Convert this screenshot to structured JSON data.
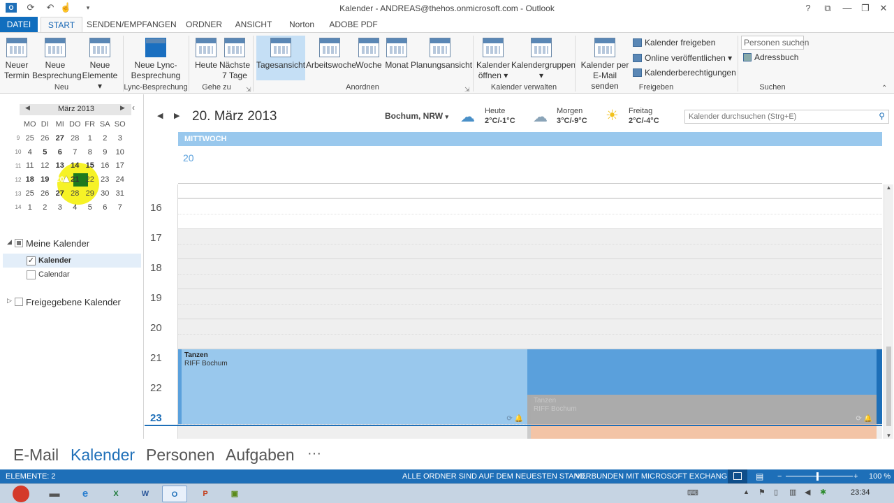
{
  "window": {
    "title": "Kalender - ANDREAS@thehos.onmicrosoft.com - Outlook",
    "help": "?"
  },
  "tabs": [
    "DATEI",
    "START",
    "SENDEN/EMPFANGEN",
    "ORDNER",
    "ANSICHT",
    "Norton",
    "ADOBE PDF"
  ],
  "ribbon": {
    "neu": {
      "termin": [
        "Neuer",
        "Termin"
      ],
      "besprechung": [
        "Neue",
        "Besprechung"
      ],
      "elemente": [
        "Neue",
        "Elemente ▾"
      ],
      "group": "Neu"
    },
    "lync": {
      "label": [
        "Neue Lync-",
        "Besprechung"
      ],
      "group": "Lync-Besprechung"
    },
    "gehezu": {
      "heute": "Heute",
      "naechste": [
        "Nächste",
        "7 Tage"
      ],
      "group": "Gehe zu"
    },
    "anordnen": {
      "items": [
        "Tagesansicht",
        "Arbeitswoche",
        "Woche",
        "Monat",
        "Planungsansicht"
      ],
      "group": "Anordnen"
    },
    "verwalten": {
      "oeffnen": [
        "Kalender",
        "öffnen ▾"
      ],
      "gruppen": [
        "Kalendergruppen",
        "▾"
      ],
      "group": "Kalender verwalten"
    },
    "freigeben": {
      "email": [
        "Kalender per",
        "E-Mail senden"
      ],
      "items": [
        "Kalender freigeben",
        "Online veröffentlichen ▾",
        "Kalenderberechtigungen"
      ],
      "group": "Freigeben"
    },
    "suchen": {
      "personen": "Personen suchen",
      "adressbuch": "Adressbuch",
      "group": "Suchen"
    }
  },
  "minical": {
    "month": "März 2013",
    "days": [
      "MO",
      "DI",
      "MI",
      "DO",
      "FR",
      "SA",
      "SO"
    ],
    "weeks": [
      [
        "9",
        "25",
        "26",
        "27",
        "28",
        "1",
        "2",
        "3"
      ],
      [
        "10",
        "4",
        "5",
        "6",
        "7",
        "8",
        "9",
        "10"
      ],
      [
        "11",
        "11",
        "12",
        "13",
        "14",
        "15",
        "16",
        "17"
      ],
      [
        "12",
        "18",
        "19",
        "20",
        "21",
        "22",
        "23",
        "24"
      ],
      [
        "13",
        "25",
        "26",
        "27",
        "28",
        "29",
        "30",
        "31"
      ],
      [
        "14",
        "1",
        "2",
        "3",
        "4",
        "5",
        "6",
        "7"
      ]
    ]
  },
  "folders": {
    "mine": "Meine Kalender",
    "kalender": "Kalender",
    "calendar": "Calendar",
    "shared": "Freigegebene Kalender"
  },
  "header": {
    "date": "20. März 2013",
    "location": "Bochum, NRW",
    "weather": [
      {
        "day": "Heute",
        "temp": "2°C/-1°C"
      },
      {
        "day": "Morgen",
        "temp": "3°C/-9°C"
      },
      {
        "day": "Freitag",
        "temp": "2°C/-4°C"
      }
    ],
    "search_placeholder": "Kalender durchsuchen (Strg+E)"
  },
  "day": {
    "name": "MITTWOCH",
    "num": "20"
  },
  "hours": [
    "16",
    "17",
    "18",
    "19",
    "20",
    "21",
    "22",
    "23"
  ],
  "event": {
    "title": "Tanzen",
    "location": "RIFF Bochum"
  },
  "ghost": {
    "title": "Tanzen",
    "location": "RIFF Bochum"
  },
  "nav": [
    "E-Mail",
    "Kalender",
    "Personen",
    "Aufgaben",
    "···"
  ],
  "status": {
    "count": "ELEMENTE: 2",
    "sync": "ALLE ORDNER SIND AUF DEM NEUESTEN STAND.",
    "conn": "VERBUNDEN MIT MICROSOFT EXCHANGE",
    "zoom": "100 %"
  },
  "clock": "23:34",
  "colors": {
    "accent": "#106ebe",
    "event": "#99c8ed",
    "event_dark": "#5aa0dc",
    "ghost": "#f3c4a6"
  }
}
